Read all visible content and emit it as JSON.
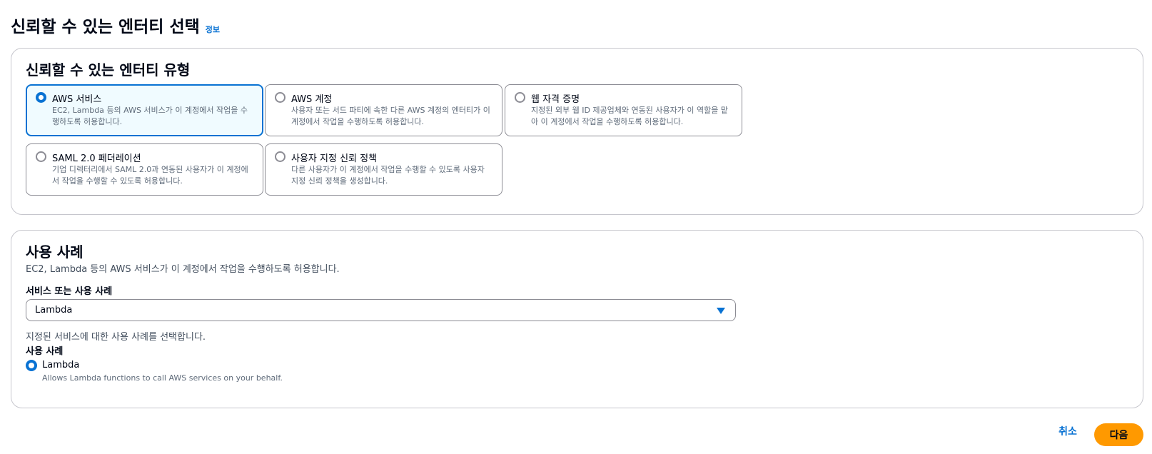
{
  "header": {
    "title": "신뢰할 수 있는 엔터티 선택",
    "info_link": "정보"
  },
  "trusted_entity": {
    "title": "신뢰할 수 있는 엔터티 유형",
    "selected": "AWS 서비스",
    "tiles": [
      {
        "label": "AWS 서비스",
        "description": "EC2, Lambda 등의 AWS 서비스가 이 계정에서 작업을 수행하도록 허용합니다.",
        "selected": true
      },
      {
        "label": "AWS 계정",
        "description": "사용자 또는 서드 파티에 속한 다른 AWS 계정의 엔터티가 이 계정에서 작업을 수행하도록 허용합니다.",
        "selected": false
      },
      {
        "label": "웹 자격 증명",
        "description": "지정된 외부 웹 ID 제공업체와 연동된 사용자가 이 역할을 맡아 이 계정에서 작업을 수행하도록 허용합니다.",
        "selected": false
      },
      {
        "label": "SAML 2.0 페더레이션",
        "description": "기업 디렉터리에서 SAML 2.0과 연동된 사용자가 이 계정에서 작업을 수행할 수 있도록 허용합니다.",
        "selected": false
      },
      {
        "label": "사용자 지정 신뢰 정책",
        "description": "다른 사용자가 이 계정에서 작업을 수행할 수 있도록 사용자 지정 신뢰 정책을 생성합니다.",
        "selected": false
      }
    ]
  },
  "use_case": {
    "title": "사용 사례",
    "description": "EC2, Lambda 등의 AWS 서비스가 이 계정에서 작업을 수행하도록 허용합니다.",
    "service_label": "서비스 또는 사용 사례",
    "service_value": "Lambda",
    "hint": "지정된 서비스에 대한 사용 사례를 선택합니다.",
    "use_case_label": "사용 사례",
    "options": [
      {
        "label": "Lambda",
        "description": "Allows Lambda functions to call AWS services on your behalf.",
        "selected": true
      }
    ]
  },
  "footer": {
    "cancel_label": "취소",
    "next_label": "다음"
  },
  "colors": {
    "accent": "#0972d3",
    "primary_button": "#ff9900",
    "selected_tile_bg": "#f0fbff"
  }
}
